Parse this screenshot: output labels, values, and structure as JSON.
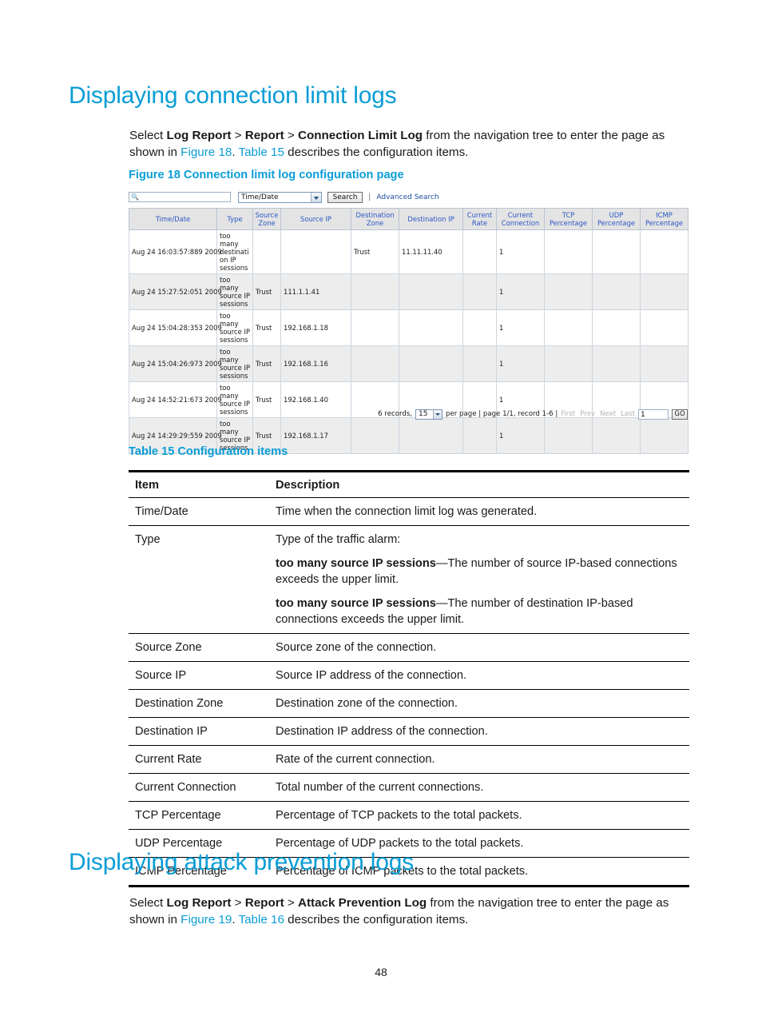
{
  "document": {
    "page_number": "48"
  },
  "section_connection": {
    "heading": "Displaying connection limit logs",
    "intro": {
      "lead": "Select ",
      "nav1": "Log Report",
      "sep1": " > ",
      "nav2": "Report",
      "sep2": " > ",
      "nav3": "Connection Limit Log",
      "mid": " from the navigation tree to enter the page as shown in ",
      "xref_figure": "Figure 18",
      "dot": ". ",
      "xref_table": "Table 15",
      "tail": " describes the configuration items."
    },
    "figure_caption": "Figure 18 Connection limit log configuration page",
    "table_caption": "Table 15 Configuration items"
  },
  "section_attack": {
    "heading": "Displaying attack prevention logs",
    "intro": {
      "lead": "Select ",
      "nav1": "Log Report",
      "sep1": " > ",
      "nav2": "Report",
      "sep2": " > ",
      "nav3": "Attack Prevention Log",
      "mid": " from the navigation tree to enter the page as shown in ",
      "xref_figure": "Figure 19",
      "dot": ". ",
      "xref_table": "Table 16",
      "tail": " describes the configuration items."
    }
  },
  "screenshot": {
    "search": {
      "input_value": "",
      "input_placeholder": "",
      "search_icon": "search-icon",
      "field_select_value": "Time/Date",
      "search_button": "Search",
      "pipe": "|",
      "advanced_search_link": "Advanced Search"
    },
    "table": {
      "columns": [
        "Time/Date",
        "Type",
        "Source Zone",
        "Source IP",
        "Destination Zone",
        "Destination IP",
        "Current Rate",
        "Current Connection",
        "TCP Percentage",
        "UDP Percentage",
        "ICMP Percentage"
      ],
      "rows": [
        {
          "time_date": "Aug 24 16:03:57:889 2009",
          "type": "too many destination IP sessions",
          "source_zone": "",
          "source_ip": "",
          "destination_zone": "Trust",
          "destination_ip": "11.11.11.40",
          "current_rate": "",
          "current_connection": "1",
          "tcp_percentage": "",
          "udp_percentage": "",
          "icmp_percentage": ""
        },
        {
          "time_date": "Aug 24 15:27:52:051 2009",
          "type": "too many source IP sessions",
          "source_zone": "Trust",
          "source_ip": "111.1.1.41",
          "destination_zone": "",
          "destination_ip": "",
          "current_rate": "",
          "current_connection": "1",
          "tcp_percentage": "",
          "udp_percentage": "",
          "icmp_percentage": ""
        },
        {
          "time_date": "Aug 24 15:04:28:353 2009",
          "type": "too many source IP sessions",
          "source_zone": "Trust",
          "source_ip": "192.168.1.18",
          "destination_zone": "",
          "destination_ip": "",
          "current_rate": "",
          "current_connection": "1",
          "tcp_percentage": "",
          "udp_percentage": "",
          "icmp_percentage": ""
        },
        {
          "time_date": "Aug 24 15:04:26:973 2009",
          "type": "too many source IP sessions",
          "source_zone": "Trust",
          "source_ip": "192.168.1.16",
          "destination_zone": "",
          "destination_ip": "",
          "current_rate": "",
          "current_connection": "1",
          "tcp_percentage": "",
          "udp_percentage": "",
          "icmp_percentage": ""
        },
        {
          "time_date": "Aug 24 14:52:21:673 2009",
          "type": "too many source IP sessions",
          "source_zone": "Trust",
          "source_ip": "192.168.1.40",
          "destination_zone": "",
          "destination_ip": "",
          "current_rate": "",
          "current_connection": "1",
          "tcp_percentage": "",
          "udp_percentage": "",
          "icmp_percentage": ""
        },
        {
          "time_date": "Aug 24 14:29:29:559 2009",
          "type": "too many source IP sessions",
          "source_zone": "Trust",
          "source_ip": "192.168.1.17",
          "destination_zone": "",
          "destination_ip": "",
          "current_rate": "",
          "current_connection": "1",
          "tcp_percentage": "",
          "udp_percentage": "",
          "icmp_percentage": ""
        }
      ]
    },
    "pager": {
      "records_label": "6 records,",
      "per_page_value": "15",
      "per_page_label": "per page | page 1/1, record 1-6 |",
      "first": "First",
      "prev": "Prev",
      "next": "Next",
      "last": "Last",
      "page_input_value": "1",
      "go_button": "GO"
    }
  },
  "config_table": {
    "headers": {
      "item": "Item",
      "description": "Description"
    },
    "rows": [
      {
        "item": "Time/Date",
        "description": "Time when the connection limit log was generated."
      },
      {
        "item": "Type",
        "desc_intro": "Type of the traffic alarm:",
        "desc_b1_bold": "too many source IP sessions",
        "desc_b1_rest": "—The number of source IP-based connections exceeds the upper limit.",
        "desc_b2_bold": "too many source IP sessions",
        "desc_b2_rest": "—The number of destination IP-based connections exceeds the upper limit."
      },
      {
        "item": "Source Zone",
        "description": "Source zone of the connection."
      },
      {
        "item": "Source IP",
        "description": "Source IP address of the connection."
      },
      {
        "item": "Destination Zone",
        "description": "Destination zone of the connection."
      },
      {
        "item": "Destination IP",
        "description": "Destination IP address of the connection."
      },
      {
        "item": "Current Rate",
        "description": "Rate of the current connection."
      },
      {
        "item": "Current Connection",
        "description": "Total number of the current connections."
      },
      {
        "item": "TCP Percentage",
        "description": "Percentage of TCP packets to the total packets."
      },
      {
        "item": "UDP Percentage",
        "description": "Percentage of UDP packets to the total packets."
      },
      {
        "item": "ICMP Percentage",
        "description": "Percentage of ICMP packets to the total packets."
      }
    ]
  },
  "colors": {
    "heading_blue": "#0b9dd6",
    "link_blue": "#0b9dd6",
    "table_header_text": "#2b57c4",
    "table_header_bg": "#e4e4e4",
    "alt_row_bg": "#ededed"
  }
}
